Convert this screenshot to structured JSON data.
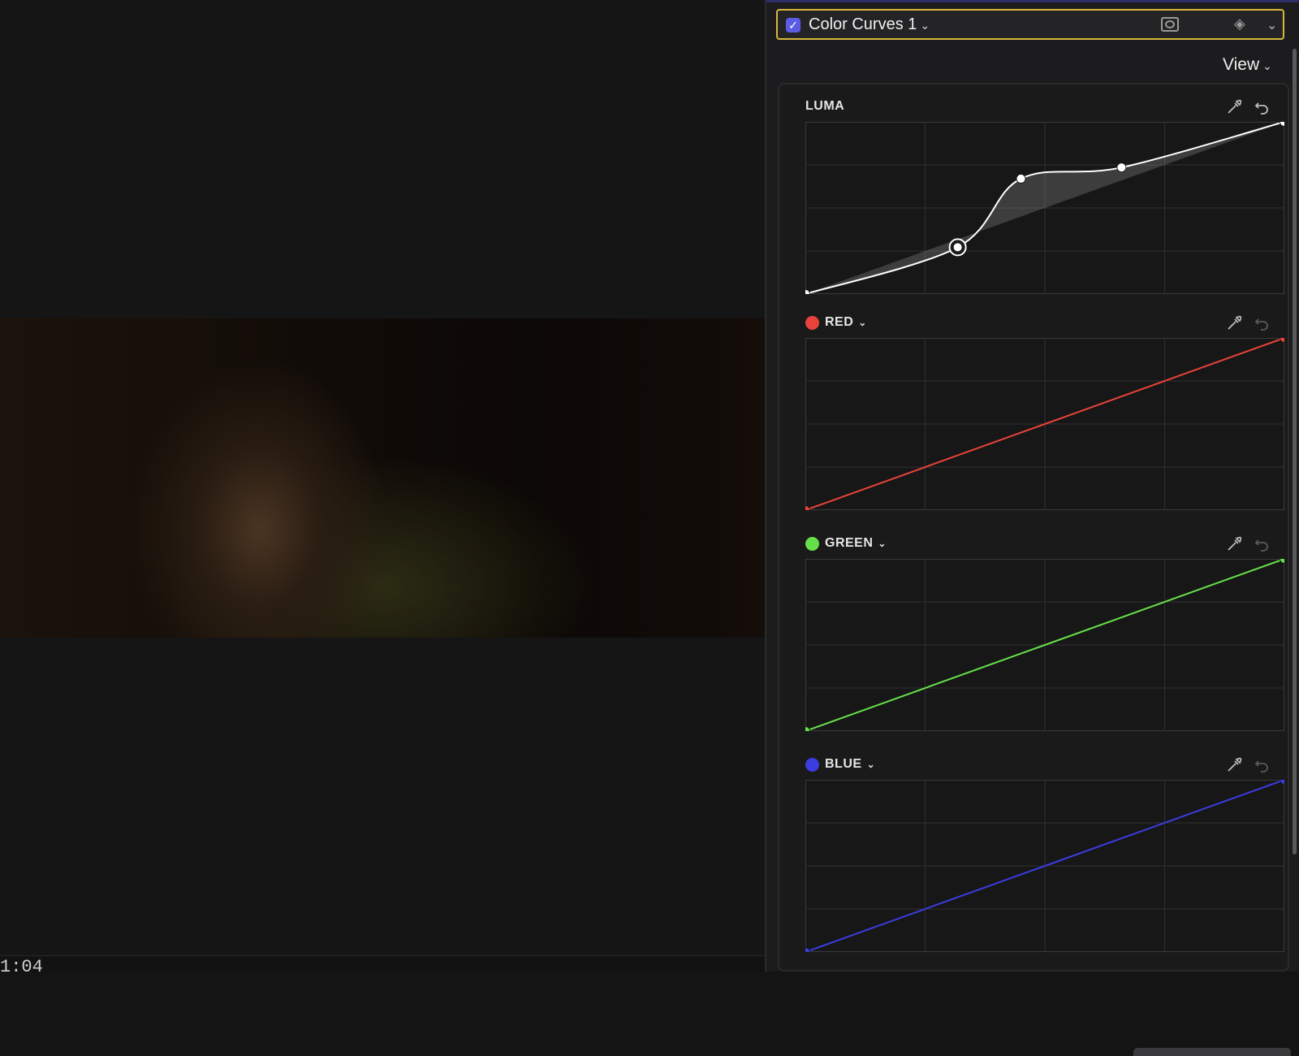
{
  "viewer": {
    "timecode": "1:04"
  },
  "inspector": {
    "effect": {
      "name": "Color Curves 1",
      "enabled": true
    },
    "view_label": "View",
    "channels": [
      {
        "id": "luma",
        "label": "LUMA",
        "color": "#ffffff"
      },
      {
        "id": "red",
        "label": "RED",
        "color": "#e8433a"
      },
      {
        "id": "green",
        "label": "GREEN",
        "color": "#66e04a"
      },
      {
        "id": "blue",
        "label": "BLUE",
        "color": "#3b3ce0"
      }
    ]
  },
  "curves": {
    "luma": [
      [
        0,
        0
      ],
      [
        0.318,
        0.272
      ],
      [
        0.45,
        0.67
      ],
      [
        0.66,
        0.735
      ],
      [
        1,
        1
      ]
    ],
    "red": [
      [
        0,
        0
      ],
      [
        1,
        1
      ]
    ],
    "green": [
      [
        0,
        0
      ],
      [
        1,
        1
      ]
    ],
    "blue": [
      [
        0,
        0
      ],
      [
        1,
        1
      ]
    ]
  }
}
